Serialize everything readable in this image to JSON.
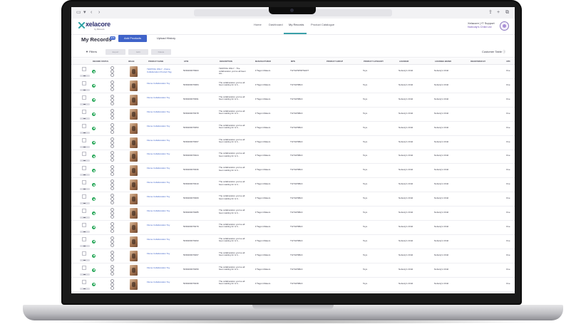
{
  "nav": {
    "links": [
      "Home",
      "Dashboard",
      "My Records",
      "Product Catalogue"
    ],
    "active": "My Records"
  },
  "brand": {
    "name": "xelacore",
    "sub": "by Bitstock"
  },
  "user": {
    "name": "Xelacore | IT Support",
    "company": "Nobody's Child Ltd"
  },
  "page": {
    "title": "My Records",
    "count_badge": "376",
    "add_button": "Add Products",
    "upload_link": "Upload History"
  },
  "toolbar": {
    "filters": "Filters",
    "buttons": [
      "Export",
      "Edit",
      "Delete"
    ],
    "customer_table": "Customer Table"
  },
  "table": {
    "columns": [
      "RECORD STATUS",
      "IMAGE",
      "PRODUCT NAME",
      "GTIN",
      "DESCRIPTION",
      "MANUFACTURER",
      "MPN",
      "PRODUCT GROUP",
      "PRODUCT CATEGORY",
      "LICENSOR",
      "LICENSEE BRAND",
      "REGISTERED BY",
      "UPD"
    ],
    "rows": [
      {
        "name_l1": "TESTING ONLY - Flume",
        "name_l2": "Collaboration Product Tag",
        "gtin": "5036460079903",
        "desc_l1": "TESTING ONLY - The",
        "desc_l2": "collaboration you've all been",
        "desc_l3": "wa...",
        "manufacturer": "F'Tagon Makers",
        "mpn": "TGTGP9P9P7EDIT",
        "category": "Toys",
        "licensor": "Nobody's Child",
        "brand": "Nobody's Child",
        "upd": "Ove"
      },
      {
        "name_l1": "Flume Collaboration Toy",
        "name_l2": "",
        "gtin": "5036460079384",
        "desc_l1": "The collaboration you've all",
        "desc_l2": "been waiting for is b...",
        "desc_l3": "",
        "manufacturer": "F'Tagon Makers",
        "mpn": "TGTGP9BLK",
        "category": "Toys",
        "licensor": "Nobody's Child",
        "brand": "Nobody's Child",
        "upd": "Ove"
      },
      {
        "name_l1": "Flume Collaboration Toy",
        "name_l2": "",
        "gtin": "5036460079391",
        "desc_l1": "The collaboration you've all",
        "desc_l2": "been waiting for is b...",
        "desc_l3": "",
        "manufacturer": "F'Tagon Makers",
        "mpn": "TGTGP9BLK",
        "category": "Toys",
        "licensor": "Nobody's Child",
        "brand": "Nobody's Child",
        "upd": "Ove"
      },
      {
        "name_l1": "Flume Collaboration Toy",
        "name_l2": "",
        "gtin": "5036460079378",
        "desc_l1": "The collaboration you've all",
        "desc_l2": "been waiting for is b...",
        "desc_l3": "",
        "manufacturer": "F'Tagon Makers",
        "mpn": "TGTGP9BLK",
        "category": "Toys",
        "licensor": "Nobody's Child",
        "brand": "Nobody's Child",
        "upd": "Ove"
      },
      {
        "name_l1": "Flume Collaboration Toy",
        "name_l2": "",
        "gtin": "5036460079353",
        "desc_l1": "The collaboration you've all",
        "desc_l2": "been waiting for is b...",
        "desc_l3": "",
        "manufacturer": "F'Tagon Makers",
        "mpn": "TGTGP9BLK",
        "category": "Toys",
        "licensor": "Nobody's Child",
        "brand": "Nobody's Child",
        "upd": "Ove"
      },
      {
        "name_l1": "Flume Collaboration Toy",
        "name_l2": "",
        "gtin": "5036460079367",
        "desc_l1": "The collaboration you've all",
        "desc_l2": "been waiting for is b...",
        "desc_l3": "",
        "manufacturer": "F'Tagon Makers",
        "mpn": "TGTGP9BLK",
        "category": "Toys",
        "licensor": "Nobody's Child",
        "brand": "Nobody's Child",
        "upd": "Ove"
      },
      {
        "name_l1": "Flume Collaboration Toy",
        "name_l2": "",
        "gtin": "5036460079324",
        "desc_l1": "The collaboration you've all",
        "desc_l2": "been waiting for is b...",
        "desc_l3": "",
        "manufacturer": "F'Tagon Makers",
        "mpn": "TGTGP9BLK",
        "category": "Toys",
        "licensor": "Nobody's Child",
        "brand": "Nobody's Child",
        "upd": "Ove"
      },
      {
        "name_l1": "Flume Collaboration Toy",
        "name_l2": "",
        "gtin": "5036460079336",
        "desc_l1": "The collaboration you've all",
        "desc_l2": "been waiting for is b...",
        "desc_l3": "",
        "manufacturer": "F'Tagon Makers",
        "mpn": "TGTGP9BLK",
        "category": "Toys",
        "licensor": "Nobody's Child",
        "brand": "Nobody's Child",
        "upd": "Ove"
      },
      {
        "name_l1": "Flume Collaboration Toy",
        "name_l2": "",
        "gtin": "5036460079310",
        "desc_l1": "The collaboration you've all",
        "desc_l2": "been waiting for is b...",
        "desc_l3": "",
        "manufacturer": "F'Tagon Makers",
        "mpn": "TGTGP9BLK",
        "category": "Toys",
        "licensor": "Nobody's Child",
        "brand": "Nobody's Child",
        "upd": "Ove"
      },
      {
        "name_l1": "Flume Collaboration Toy",
        "name_l2": "",
        "gtin": "5036460079309",
        "desc_l1": "The collaboration you've all",
        "desc_l2": "been waiting for is b...",
        "desc_l3": "",
        "manufacturer": "F'Tagon Makers",
        "mpn": "TGTGP9BLK",
        "category": "Toys",
        "licensor": "Nobody's Child",
        "brand": "Nobody's Child",
        "upd": "Ove"
      },
      {
        "name_l1": "Flume Collaboration Toy",
        "name_l2": "",
        "gtin": "5036460079285",
        "desc_l1": "The collaboration you've all",
        "desc_l2": "been waiting for is b...",
        "desc_l3": "",
        "manufacturer": "F'Tagon Makers",
        "mpn": "TGTGP9BLK",
        "category": "Toys",
        "licensor": "Nobody's Child",
        "brand": "Nobody's Child",
        "upd": "Ove"
      },
      {
        "name_l1": "Flume Collaboration Toy",
        "name_l2": "",
        "gtin": "5036460079279",
        "desc_l1": "The collaboration you've all",
        "desc_l2": "been waiting for is b...",
        "desc_l3": "",
        "manufacturer": "F'Tagon Makers",
        "mpn": "TGTGP9BLK",
        "category": "Toys",
        "licensor": "Nobody's Child",
        "brand": "Nobody's Child",
        "upd": "Ove"
      },
      {
        "name_l1": "Flume Collaboration Toy",
        "name_l2": "",
        "gtin": "5036460079293",
        "desc_l1": "The collaboration you've all",
        "desc_l2": "been waiting for is b...",
        "desc_l3": "",
        "manufacturer": "F'Tagon Makers",
        "mpn": "TGTGP9BLK",
        "category": "Toys",
        "licensor": "Nobody's Child",
        "brand": "Nobody's Child",
        "upd": "Ove"
      },
      {
        "name_l1": "Flume Collaboration Toy",
        "name_l2": "",
        "gtin": "5036460079267",
        "desc_l1": "The collaboration you've all",
        "desc_l2": "been waiting for is b...",
        "desc_l3": "",
        "manufacturer": "F'Tagon Makers",
        "mpn": "TGTGP9BLK",
        "category": "Toys",
        "licensor": "Nobody's Child",
        "brand": "Nobody's Child",
        "upd": "Ove"
      },
      {
        "name_l1": "Flume Collaboration Toy",
        "name_l2": "",
        "gtin": "5036460079259",
        "desc_l1": "The collaboration you've all",
        "desc_l2": "been waiting for is b...",
        "desc_l3": "",
        "manufacturer": "F'Tagon Makers",
        "mpn": "TGTGP9BLK",
        "category": "Toys",
        "licensor": "Nobody's Child",
        "brand": "Nobody's Child",
        "upd": "Ove"
      },
      {
        "name_l1": "Flume Collaboration Toy",
        "name_l2": "",
        "gtin": "5036460079236",
        "desc_l1": "The collaboration you've all",
        "desc_l2": "been waiting for is b...",
        "desc_l3": "",
        "manufacturer": "F'Tagon Makers",
        "mpn": "TGTGP9BLK",
        "category": "Toys",
        "licensor": "Nobody's Child",
        "brand": "Nobody's Child",
        "upd": "Ove"
      }
    ]
  }
}
